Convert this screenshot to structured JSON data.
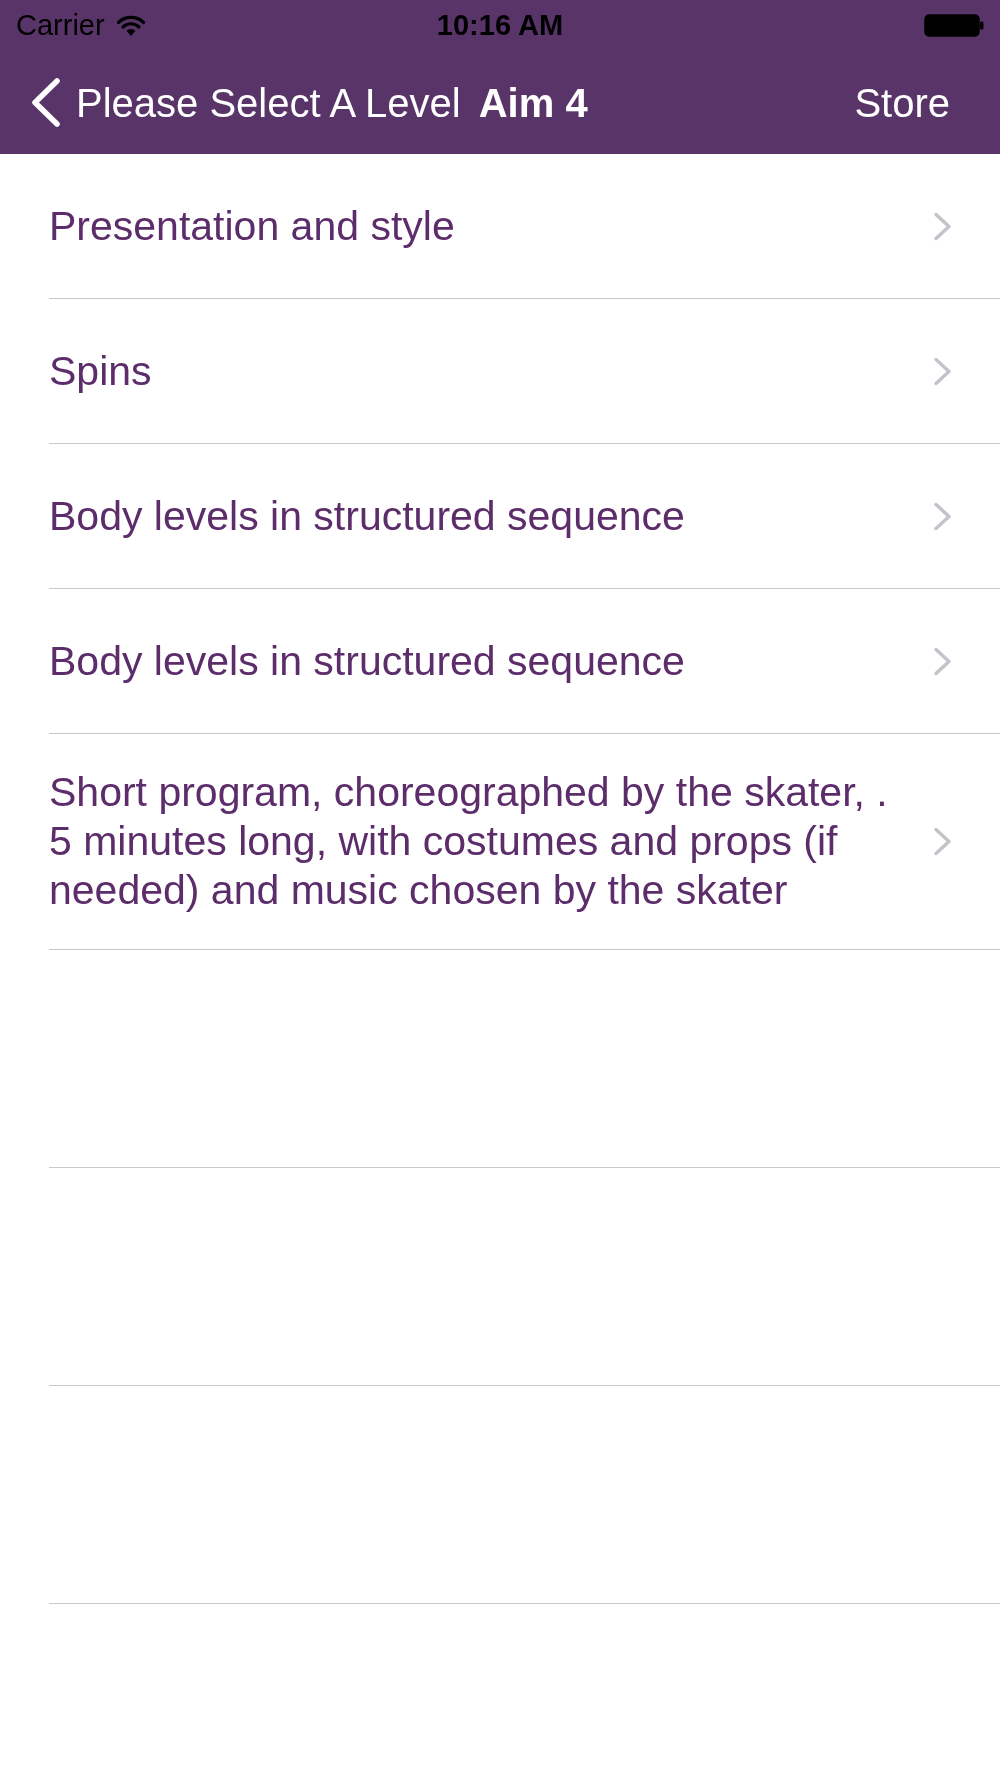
{
  "status_bar": {
    "carrier": "Carrier",
    "time": "10:16 AM"
  },
  "nav_bar": {
    "back_label": "Please Select A Level",
    "title": "Aim 4",
    "right_button": "Store"
  },
  "rows": [
    {
      "label": "Presentation and style"
    },
    {
      "label": "Spins"
    },
    {
      "label": "Body levels in structured sequence"
    },
    {
      "label": "Body levels in structured sequence"
    },
    {
      "label": "Short program, choreographed by the skater, . 5 minutes long, with costumes and props (if needed) and music chosen by the skater"
    }
  ]
}
